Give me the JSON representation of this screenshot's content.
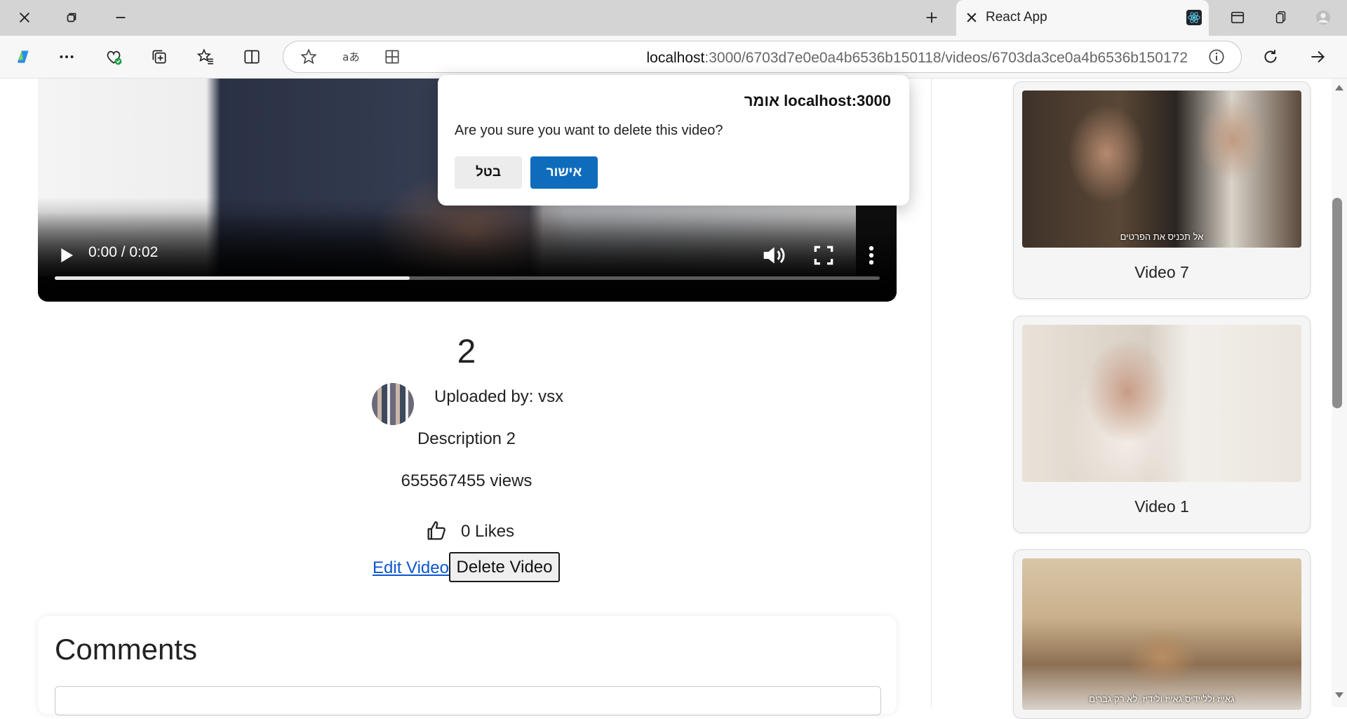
{
  "browser": {
    "tab_title": "React App",
    "url_host": "localhost",
    "url_path": ":3000/6703d7e0e0a4b6536b150118/videos/6703da3ce0a4b6536b150172"
  },
  "video": {
    "time": "0:00 / 0:02",
    "progress_fraction": 0.43,
    "title": "2",
    "uploaded_by": "Uploaded by: vsx",
    "description": "Description 2",
    "views": "655567455 views",
    "likes": "0 Likes",
    "edit_label": "Edit Video",
    "delete_label": "Delete Video"
  },
  "comments": {
    "title": "Comments"
  },
  "sidebar": {
    "videos": [
      {
        "label": "Video 7",
        "caption": "אל תכניס את הפרטים"
      },
      {
        "label": "Video 1",
        "caption": ""
      },
      {
        "label": "",
        "caption": "גאייז ולליידיס גאייז ולידיז, לא רק גברים"
      }
    ]
  },
  "dialog": {
    "title": "localhost:3000 אומר",
    "message": "Are you sure you want to delete this video?",
    "ok_label": "אישור",
    "cancel_label": "בטל"
  },
  "colors": {
    "accent": "#0f6cbd",
    "link": "#0b57d0"
  }
}
